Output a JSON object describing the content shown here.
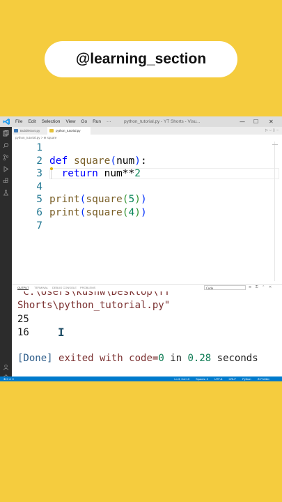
{
  "overlay": {
    "channel_handle": "@learning_section"
  },
  "app": {
    "menu": [
      "File",
      "Edit",
      "Selection",
      "View",
      "Go",
      "Run",
      "···"
    ],
    "window_title": "python_tutorial.py - YT Shorts - Visu..."
  },
  "tabs": [
    {
      "label": "BubbleSort.py",
      "active": false
    },
    {
      "label": "python_tutorial.py",
      "active": true
    }
  ],
  "breadcrumb": "python_tutorial.py > ⊕ square",
  "editor": {
    "line_numbers": [
      "1",
      "2",
      "3",
      "4",
      "5",
      "6",
      "7"
    ],
    "lines": [
      "",
      "def square(num):",
      "  return num**2",
      "",
      "print(square(5))",
      "print(square(4))",
      ""
    ]
  },
  "panel": {
    "tabs": [
      "OUTPUT",
      "TERMINAL",
      "DEBUG CONSOLE",
      "PROBLEMS"
    ],
    "select": "Code",
    "output": {
      "path_line1": "\"C:\\Users\\kushw\\Desktop\\YT",
      "path_line2": "Shorts\\python_tutorial.py\"",
      "results": [
        "25",
        "16"
      ],
      "done_label": "[Done]",
      "done_text": "exited with code=",
      "exit_code": "0",
      "in_text": "in",
      "time": "0.28",
      "seconds": "seconds"
    }
  },
  "status": {
    "left": "⊗ 0 ⚠ 0",
    "right": [
      "Ln 3, Col 13",
      "Spaces: 2",
      "UTF-8",
      "CRLF",
      "Python",
      "⊘ Prettier"
    ]
  },
  "colors": {
    "background": "#f5cc3e",
    "status_bar": "#007acc",
    "activity_bar": "#2c2c2c"
  }
}
